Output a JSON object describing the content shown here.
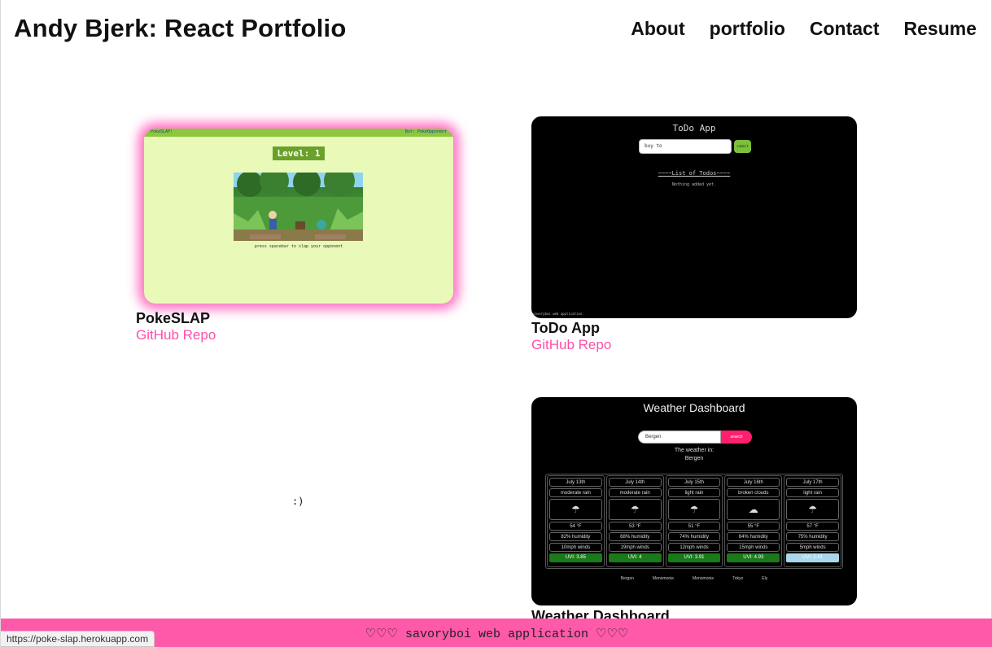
{
  "header": {
    "title": "Andy Bjerk: React Portfolio",
    "nav": [
      "About",
      "portfolio",
      "Contact",
      "Resume"
    ]
  },
  "projects": [
    {
      "title": "PokeSLAP",
      "link": "GitHub Repo",
      "screenshot": {
        "topbar_left": "PokeSLAP!",
        "topbar_right": "Bot: PokeOpponent",
        "level": "Level: 1",
        "caption": "press spacebar to slap your opponent"
      }
    },
    {
      "title": "ToDo App",
      "link": "GitHub Repo",
      "screenshot": {
        "title": "ToDo App",
        "input_value": "buy to",
        "submit": "submit",
        "list_title": "~~~~List of Todos~~~~",
        "empty": "Nothing added yet.",
        "footer": "savoryboi web application♡"
      }
    },
    {
      "title": "Weather Dashboard",
      "screenshot": {
        "title": "Weather Dashboard",
        "input_value": "Bergen",
        "search": "search",
        "label": "The weather in:",
        "city": "Bergen",
        "days": [
          {
            "date": "July 13th",
            "desc": "moderate rain",
            "icon": "rain-cloud-icon",
            "temp": "54 °F",
            "humidity": "82% humidity",
            "wind": "10mph winds",
            "uvi": "UVI: 3.85",
            "uvi_color": "#1a7a1a"
          },
          {
            "date": "July 14th",
            "desc": "moderate rain",
            "icon": "rain-cloud-icon",
            "temp": "53 °F",
            "humidity": "68% humidity",
            "wind": "19mph winds",
            "uvi": "UVI: 4",
            "uvi_color": "#1a7a1a"
          },
          {
            "date": "July 15th",
            "desc": "light rain",
            "icon": "rain-cloud-icon",
            "temp": "51 °F",
            "humidity": "74% humidity",
            "wind": "12mph winds",
            "uvi": "UVI: 3.91",
            "uvi_color": "#1a7a1a"
          },
          {
            "date": "July 16th",
            "desc": "broken clouds",
            "icon": "cloud-icon",
            "temp": "55 °F",
            "humidity": "64% humidity",
            "wind": "15mph winds",
            "uvi": "UVI: 4.93",
            "uvi_color": "#1a7a1a"
          },
          {
            "date": "July 17th",
            "desc": "light rain",
            "icon": "rain-cloud-icon",
            "temp": "57 °F",
            "humidity": "75% humidity",
            "wind": "5mph winds",
            "uvi": "UVI: 2.41",
            "uvi_color": "#a8d8ea"
          }
        ],
        "history": [
          "Bergen",
          "Menomonie",
          "Menomonie",
          "Tokyo",
          "Ely"
        ]
      }
    }
  ],
  "placeholder_text": ":)",
  "footer": {
    "text": "♡♡♡ savoryboi web application ♡♡♡"
  },
  "status_bar": {
    "url": "https://poke-slap.herokuapp.com"
  },
  "colors": {
    "accent_pink": "#ff59a9",
    "link_pink": "#ff4fa7",
    "glow_pink": "#ff6fc2"
  }
}
